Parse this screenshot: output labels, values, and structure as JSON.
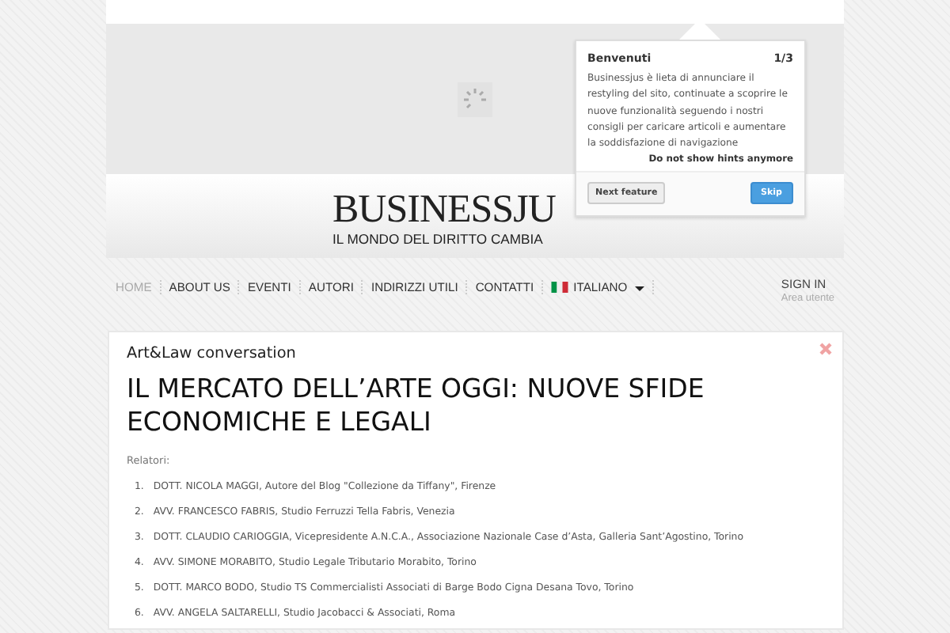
{
  "header": {
    "logo": "BUSINESSJU",
    "tagline": "IL MONDO DEL DIRITTO CAMBIA"
  },
  "tour_popup": {
    "title": "Benvenuti",
    "step": "1/3",
    "body": "Businessjus è lieta di annunciare il restyling del sito, continuate a scoprire le nuove funzionalità seguendo i nostri consigli per caricare articoli e aumentare la soddisfazione di navigazione",
    "dismiss_link": "Do not show hints anymore",
    "buttons": [
      {
        "label": "Next feature",
        "kind": "secondary"
      },
      {
        "label": "Skip",
        "kind": "primary"
      }
    ]
  },
  "nav": {
    "items": [
      {
        "label": "HOME",
        "selected": true,
        "kind": "link"
      },
      {
        "label": "ABOUT US",
        "selected": false,
        "kind": "link"
      },
      {
        "label": "EVENTI",
        "selected": false,
        "kind": "link"
      },
      {
        "label": "AUTORI",
        "selected": false,
        "kind": "link"
      },
      {
        "label": "INDIRIZZI UTILI",
        "selected": false,
        "kind": "link"
      },
      {
        "label": "CONTATTI",
        "selected": false,
        "kind": "link"
      },
      {
        "label": "ITALIANO",
        "selected": false,
        "kind": "language"
      }
    ],
    "sign_in": {
      "label": "SIGN IN",
      "sublabel": "Area utente"
    }
  },
  "article": {
    "category": "Art&Law conversation",
    "title": "IL MERCATO DELL’ARTE OGGI: NUOVE SFIDE ECONOMICHE E LEGALI",
    "speakers_label": "Relatori:",
    "speakers": [
      {
        "number": "1.",
        "text": "DOTT. NICOLA MAGGI, Autore del Blog \"Collezione da Tiffany\", Firenze"
      },
      {
        "number": "2.",
        "text": "AVV. FRANCESCO FABRIS, Studio Ferruzzi Tella Fabris, Venezia"
      },
      {
        "number": "3.",
        "text": "DOTT. CLAUDIO CARIOGGIA, Vicepresidente A.N.C.A., Associazione Nazionale Case d’Asta, Galleria Sant’Agostino, Torino"
      },
      {
        "number": "4.",
        "text": "AVV. SIMONE MORABITO, Studio Legale Tributario Morabito, Torino"
      },
      {
        "number": "5.",
        "text": "DOTT. MARCO BODO, Studio TS Commercialisti Associati di Barge Bodo Cigna Desana Tovo, Torino"
      },
      {
        "number": "6.",
        "text": "AVV. ANGELA SALTARELLI, Studio Jacobacci & Associati, Roma"
      }
    ]
  }
}
